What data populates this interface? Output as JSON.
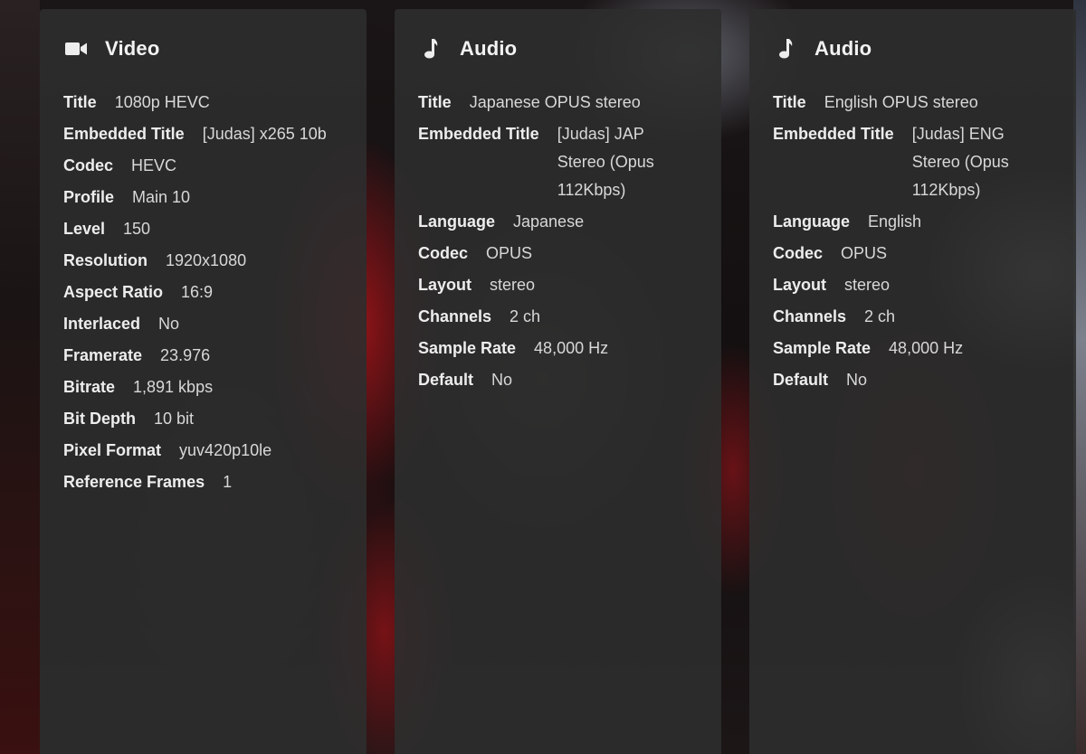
{
  "streams": [
    {
      "type_label": "Video",
      "icon": "video-camera-icon",
      "fields": [
        {
          "label": "Title",
          "value": "1080p HEVC"
        },
        {
          "label": "Embedded Title",
          "value": "[Judas] x265 10b"
        },
        {
          "label": "Codec",
          "value": "HEVC"
        },
        {
          "label": "Profile",
          "value": "Main 10"
        },
        {
          "label": "Level",
          "value": "150"
        },
        {
          "label": "Resolution",
          "value": "1920x1080"
        },
        {
          "label": "Aspect Ratio",
          "value": "16:9"
        },
        {
          "label": "Interlaced",
          "value": "No"
        },
        {
          "label": "Framerate",
          "value": "23.976"
        },
        {
          "label": "Bitrate",
          "value": "1,891 kbps"
        },
        {
          "label": "Bit Depth",
          "value": "10 bit"
        },
        {
          "label": "Pixel Format",
          "value": "yuv420p10le"
        },
        {
          "label": "Reference Frames",
          "value": "1"
        }
      ]
    },
    {
      "type_label": "Audio",
      "icon": "music-note-icon",
      "fields": [
        {
          "label": "Title",
          "value": "Japanese OPUS stereo"
        },
        {
          "label": "Embedded Title",
          "value": "[Judas] JAP Stereo (Opus 112Kbps)"
        },
        {
          "label": "Language",
          "value": "Japanese"
        },
        {
          "label": "Codec",
          "value": "OPUS"
        },
        {
          "label": "Layout",
          "value": "stereo"
        },
        {
          "label": "Channels",
          "value": "2 ch"
        },
        {
          "label": "Sample Rate",
          "value": "48,000 Hz"
        },
        {
          "label": "Default",
          "value": "No"
        }
      ]
    },
    {
      "type_label": "Audio",
      "icon": "music-note-icon",
      "fields": [
        {
          "label": "Title",
          "value": "English OPUS stereo"
        },
        {
          "label": "Embedded Title",
          "value": "[Judas] ENG Stereo (Opus 112Kbps)"
        },
        {
          "label": "Language",
          "value": "English"
        },
        {
          "label": "Codec",
          "value": "OPUS"
        },
        {
          "label": "Layout",
          "value": "stereo"
        },
        {
          "label": "Channels",
          "value": "2 ch"
        },
        {
          "label": "Sample Rate",
          "value": "48,000 Hz"
        },
        {
          "label": "Default",
          "value": "No"
        }
      ]
    }
  ]
}
